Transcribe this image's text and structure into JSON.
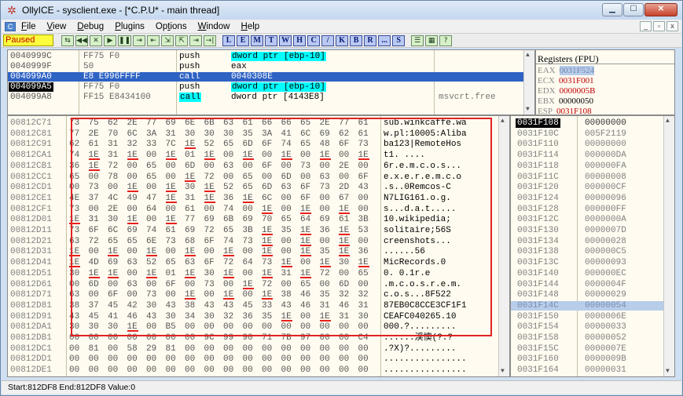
{
  "window": {
    "title": "OllyICE - sysclient.exe - [*C.P.U* - main thread]",
    "controls": {
      "minimize": "▁",
      "maximize": "☐",
      "close": "✕"
    }
  },
  "menu": {
    "items": [
      {
        "label": "File",
        "key": "F"
      },
      {
        "label": "View",
        "key": "V"
      },
      {
        "label": "Debug",
        "key": "D"
      },
      {
        "label": "Plugins",
        "key": "P"
      },
      {
        "label": "Options",
        "key": "t"
      },
      {
        "label": "Window",
        "key": "W"
      },
      {
        "label": "Help",
        "key": "H"
      }
    ],
    "mdi": [
      "_",
      "▫",
      "x"
    ]
  },
  "toolbar": {
    "status": "Paused",
    "buttons": [
      "⇆",
      "◀◀",
      "✕",
      "▶",
      "❚❚",
      "⇥",
      "⇤",
      "⇲",
      "⇱",
      "⇥",
      "→|"
    ],
    "letter_buttons": [
      "L",
      "E",
      "M",
      "T",
      "W",
      "H",
      "C",
      "/",
      "K",
      "B",
      "R",
      "...",
      "S"
    ],
    "extra_buttons": [
      "☰",
      "▦",
      "?"
    ]
  },
  "disasm": {
    "rows": [
      {
        "addr": "0040999C",
        "hex": "FF75 F0",
        "cmd": "push",
        "op": "dword ptr [ebp-10]",
        "comment": "",
        "op_hl": true
      },
      {
        "addr": "0040999F",
        "hex": "50",
        "cmd": "push",
        "op": "eax",
        "comment": ""
      },
      {
        "addr": "004099A0",
        "hex": "E8 E996FFFF",
        "cmd": "call",
        "op": "0040308E",
        "comment": "",
        "selected": true
      },
      {
        "addr": "004099A5",
        "hex": "FF75 F0",
        "cmd": "push",
        "op": "dword ptr [ebp-10]",
        "comment": "",
        "current": true,
        "op_hl": true
      },
      {
        "addr": "004099A8",
        "hex": "FF15 E8434100",
        "cmd": "call",
        "op": "dword ptr [4143E8]",
        "comment": "msvcrt.free",
        "cmd_hl": true
      }
    ]
  },
  "registers": {
    "title": "Registers (FPU)",
    "items": [
      {
        "name": "EAX",
        "value": "0031F524",
        "style": "sel"
      },
      {
        "name": "ECX",
        "value": "0031F001",
        "style": "changed"
      },
      {
        "name": "EDX",
        "value": "0000005B",
        "style": "changed"
      },
      {
        "name": "EBX",
        "value": "00000050",
        "style": ""
      },
      {
        "name": "ESP",
        "value": "0031F108",
        "style": "changed"
      }
    ]
  },
  "dump": {
    "rows": [
      {
        "addr": "00812C71",
        "bytes": [
          "73",
          "75",
          "62",
          "2E",
          "77",
          "69",
          "6E",
          "6B",
          "63",
          "61",
          "66",
          "66",
          "65",
          "2E",
          "77",
          "61"
        ],
        "ascii": "sub.winkcaffe.wa"
      },
      {
        "addr": "00812C81",
        "bytes": [
          "77",
          "2E",
          "70",
          "6C",
          "3A",
          "31",
          "30",
          "30",
          "30",
          "35",
          "3A",
          "41",
          "6C",
          "69",
          "62",
          "61"
        ],
        "ascii": "w.pl:10005:Aliba"
      },
      {
        "addr": "00812C91",
        "bytes": [
          "62",
          "61",
          "31",
          "32",
          "33",
          "7C",
          "1E",
          "52",
          "65",
          "6D",
          "6F",
          "74",
          "65",
          "48",
          "6F",
          "73"
        ],
        "ascii": "ba123|RemoteHos"
      },
      {
        "addr": "00812CA1",
        "bytes": [
          "74",
          "1E",
          "31",
          "1E",
          "00",
          "1E",
          "01",
          "1E",
          "00",
          "1E",
          "00",
          "1E",
          "00",
          "1E",
          "00",
          "1E"
        ],
        "ascii": "t1.    ...."
      },
      {
        "addr": "00812CB1",
        "bytes": [
          "36",
          "1E",
          "72",
          "00",
          "65",
          "00",
          "6D",
          "00",
          "63",
          "00",
          "6F",
          "00",
          "73",
          "00",
          "2E",
          "00"
        ],
        "ascii": "6r.e.m.c.o.s..."
      },
      {
        "addr": "00812CC1",
        "bytes": [
          "65",
          "00",
          "78",
          "00",
          "65",
          "00",
          "1E",
          "72",
          "00",
          "65",
          "00",
          "6D",
          "00",
          "63",
          "00",
          "6F"
        ],
        "ascii": "e.x.e.r.e.m.c.o"
      },
      {
        "addr": "00812CD1",
        "bytes": [
          "00",
          "73",
          "00",
          "1E",
          "00",
          "1E",
          "30",
          "1E",
          "52",
          "65",
          "6D",
          "63",
          "6F",
          "73",
          "2D",
          "43"
        ],
        "ascii": ".s..0Remcos-C"
      },
      {
        "addr": "00812CE1",
        "bytes": [
          "4E",
          "37",
          "4C",
          "49",
          "47",
          "1E",
          "31",
          "1E",
          "36",
          "1E",
          "6C",
          "00",
          "6F",
          "00",
          "67",
          "00"
        ],
        "ascii": "N7LIG161.o.g."
      },
      {
        "addr": "00812CF1",
        "bytes": [
          "73",
          "00",
          "2E",
          "00",
          "64",
          "00",
          "61",
          "00",
          "74",
          "00",
          "1E",
          "00",
          "1E",
          "00",
          "1E",
          "00"
        ],
        "ascii": "s...d.a.t....."
      },
      {
        "addr": "00812D01",
        "bytes": [
          "1E",
          "31",
          "30",
          "1E",
          "00",
          "1E",
          "77",
          "69",
          "6B",
          "69",
          "70",
          "65",
          "64",
          "69",
          "61",
          "3B"
        ],
        "ascii": "10.wikipedia;"
      },
      {
        "addr": "00812D11",
        "bytes": [
          "73",
          "6F",
          "6C",
          "69",
          "74",
          "61",
          "69",
          "72",
          "65",
          "3B",
          "1E",
          "35",
          "1E",
          "36",
          "1E",
          "53"
        ],
        "ascii": "solitaire;56S"
      },
      {
        "addr": "00812D21",
        "bytes": [
          "63",
          "72",
          "65",
          "65",
          "6E",
          "73",
          "68",
          "6F",
          "74",
          "73",
          "1E",
          "00",
          "1E",
          "00",
          "1E",
          "00"
        ],
        "ascii": "creenshots..."
      },
      {
        "addr": "00812D31",
        "bytes": [
          "1E",
          "00",
          "1E",
          "00",
          "1E",
          "00",
          "1E",
          "00",
          "1E",
          "00",
          "1E",
          "00",
          "1E",
          "35",
          "1E",
          "36"
        ],
        "ascii": "......56"
      },
      {
        "addr": "00812D41",
        "bytes": [
          "1E",
          "4D",
          "69",
          "63",
          "52",
          "65",
          "63",
          "6F",
          "72",
          "64",
          "73",
          "1E",
          "00",
          "1E",
          "30",
          "1E"
        ],
        "ascii": "MicRecords.0"
      },
      {
        "addr": "00812D51",
        "bytes": [
          "30",
          "1E",
          "1E",
          "00",
          "1E",
          "01",
          "1E",
          "30",
          "1E",
          "00",
          "1E",
          "31",
          "1E",
          "72",
          "00",
          "65"
        ],
        "ascii": "0.   0.1r.e"
      },
      {
        "addr": "00812D61",
        "bytes": [
          "00",
          "6D",
          "00",
          "63",
          "00",
          "6F",
          "00",
          "73",
          "00",
          "1E",
          "72",
          "00",
          "65",
          "00",
          "6D",
          "00"
        ],
        "ascii": ".m.c.o.s.r.e.m."
      },
      {
        "addr": "00812D71",
        "bytes": [
          "63",
          "00",
          "6F",
          "00",
          "73",
          "00",
          "1E",
          "00",
          "1E",
          "00",
          "1E",
          "38",
          "46",
          "35",
          "32",
          "32"
        ],
        "ascii": "c.o.s...8F522"
      },
      {
        "addr": "00812D81",
        "bytes": [
          "38",
          "37",
          "45",
          "42",
          "30",
          "43",
          "38",
          "43",
          "43",
          "45",
          "33",
          "43",
          "46",
          "31",
          "46",
          "31"
        ],
        "ascii": "87EB0C8CCE3CF1F1"
      },
      {
        "addr": "00812D91",
        "bytes": [
          "43",
          "45",
          "41",
          "46",
          "43",
          "30",
          "34",
          "30",
          "32",
          "36",
          "35",
          "1E",
          "00",
          "1E",
          "31",
          "30"
        ],
        "ascii": "CEAFC040265.10"
      },
      {
        "addr": "00812DA1",
        "bytes": [
          "30",
          "30",
          "30",
          "1E",
          "00",
          "B5",
          "00",
          "00",
          "00",
          "00",
          "00",
          "00",
          "00",
          "00",
          "00",
          "00"
        ],
        "ascii": "000.?........."
      },
      {
        "addr": "00812DB1",
        "bytes": [
          "00",
          "00",
          "00",
          "00",
          "00",
          "00",
          "00",
          "9C",
          "99",
          "90",
          "71",
          "7B",
          "97",
          "00",
          "00",
          "C4"
        ],
        "ascii": "......渓懊(?.?"
      },
      {
        "addr": "00812DC1",
        "bytes": [
          "00",
          "81",
          "00",
          "58",
          "29",
          "81",
          "00",
          "00",
          "00",
          "00",
          "00",
          "00",
          "00",
          "00",
          "00",
          "00"
        ],
        "ascii": ".?X)?........."
      },
      {
        "addr": "00812DD1",
        "bytes": [
          "00",
          "00",
          "00",
          "00",
          "00",
          "00",
          "00",
          "00",
          "00",
          "00",
          "00",
          "00",
          "00",
          "00",
          "00",
          "00"
        ],
        "ascii": "................"
      },
      {
        "addr": "00812DE1",
        "bytes": [
          "00",
          "00",
          "00",
          "00",
          "00",
          "00",
          "00",
          "00",
          "00",
          "00",
          "00",
          "00",
          "00",
          "00",
          "00",
          "00"
        ],
        "ascii": "................"
      }
    ]
  },
  "stack": {
    "rows": [
      {
        "addr": "0031F108",
        "value": "00000000",
        "style": "top"
      },
      {
        "addr": "0031F10C",
        "value": "005F2119",
        "style": ""
      },
      {
        "addr": "0031F110",
        "value": "00000000",
        "style": ""
      },
      {
        "addr": "0031F114",
        "value": "000000DA",
        "style": ""
      },
      {
        "addr": "0031F118",
        "value": "000000FA",
        "style": ""
      },
      {
        "addr": "0031F11C",
        "value": "00000008",
        "style": ""
      },
      {
        "addr": "0031F120",
        "value": "000000CF",
        "style": ""
      },
      {
        "addr": "0031F124",
        "value": "00000096",
        "style": ""
      },
      {
        "addr": "0031F128",
        "value": "000000FF",
        "style": ""
      },
      {
        "addr": "0031F12C",
        "value": "0000000A",
        "style": ""
      },
      {
        "addr": "0031F130",
        "value": "0000007D",
        "style": ""
      },
      {
        "addr": "0031F134",
        "value": "00000028",
        "style": ""
      },
      {
        "addr": "0031F138",
        "value": "000000C5",
        "style": ""
      },
      {
        "addr": "0031F13C",
        "value": "00000093",
        "style": ""
      },
      {
        "addr": "0031F140",
        "value": "000000EC",
        "style": ""
      },
      {
        "addr": "0031F144",
        "value": "0000004F",
        "style": ""
      },
      {
        "addr": "0031F148",
        "value": "00000029",
        "style": ""
      },
      {
        "addr": "0031F14C",
        "value": "00000054",
        "style": "hl"
      },
      {
        "addr": "0031F150",
        "value": "0000006E",
        "style": ""
      },
      {
        "addr": "0031F154",
        "value": "00000033",
        "style": ""
      },
      {
        "addr": "0031F158",
        "value": "00000052",
        "style": ""
      },
      {
        "addr": "0031F15C",
        "value": "0000007E",
        "style": ""
      },
      {
        "addr": "0031F160",
        "value": "0000009B",
        "style": ""
      },
      {
        "addr": "0031F164",
        "value": "00000031",
        "style": ""
      }
    ]
  },
  "statusbar": {
    "text": "Start:812DF8 End:812DF8 Value:0"
  },
  "colors": {
    "selection": "#2e63c4",
    "highlight": "#00ffff",
    "changed": "#c00000",
    "paused": "#fcfc3c",
    "annotation": "#e02323"
  }
}
